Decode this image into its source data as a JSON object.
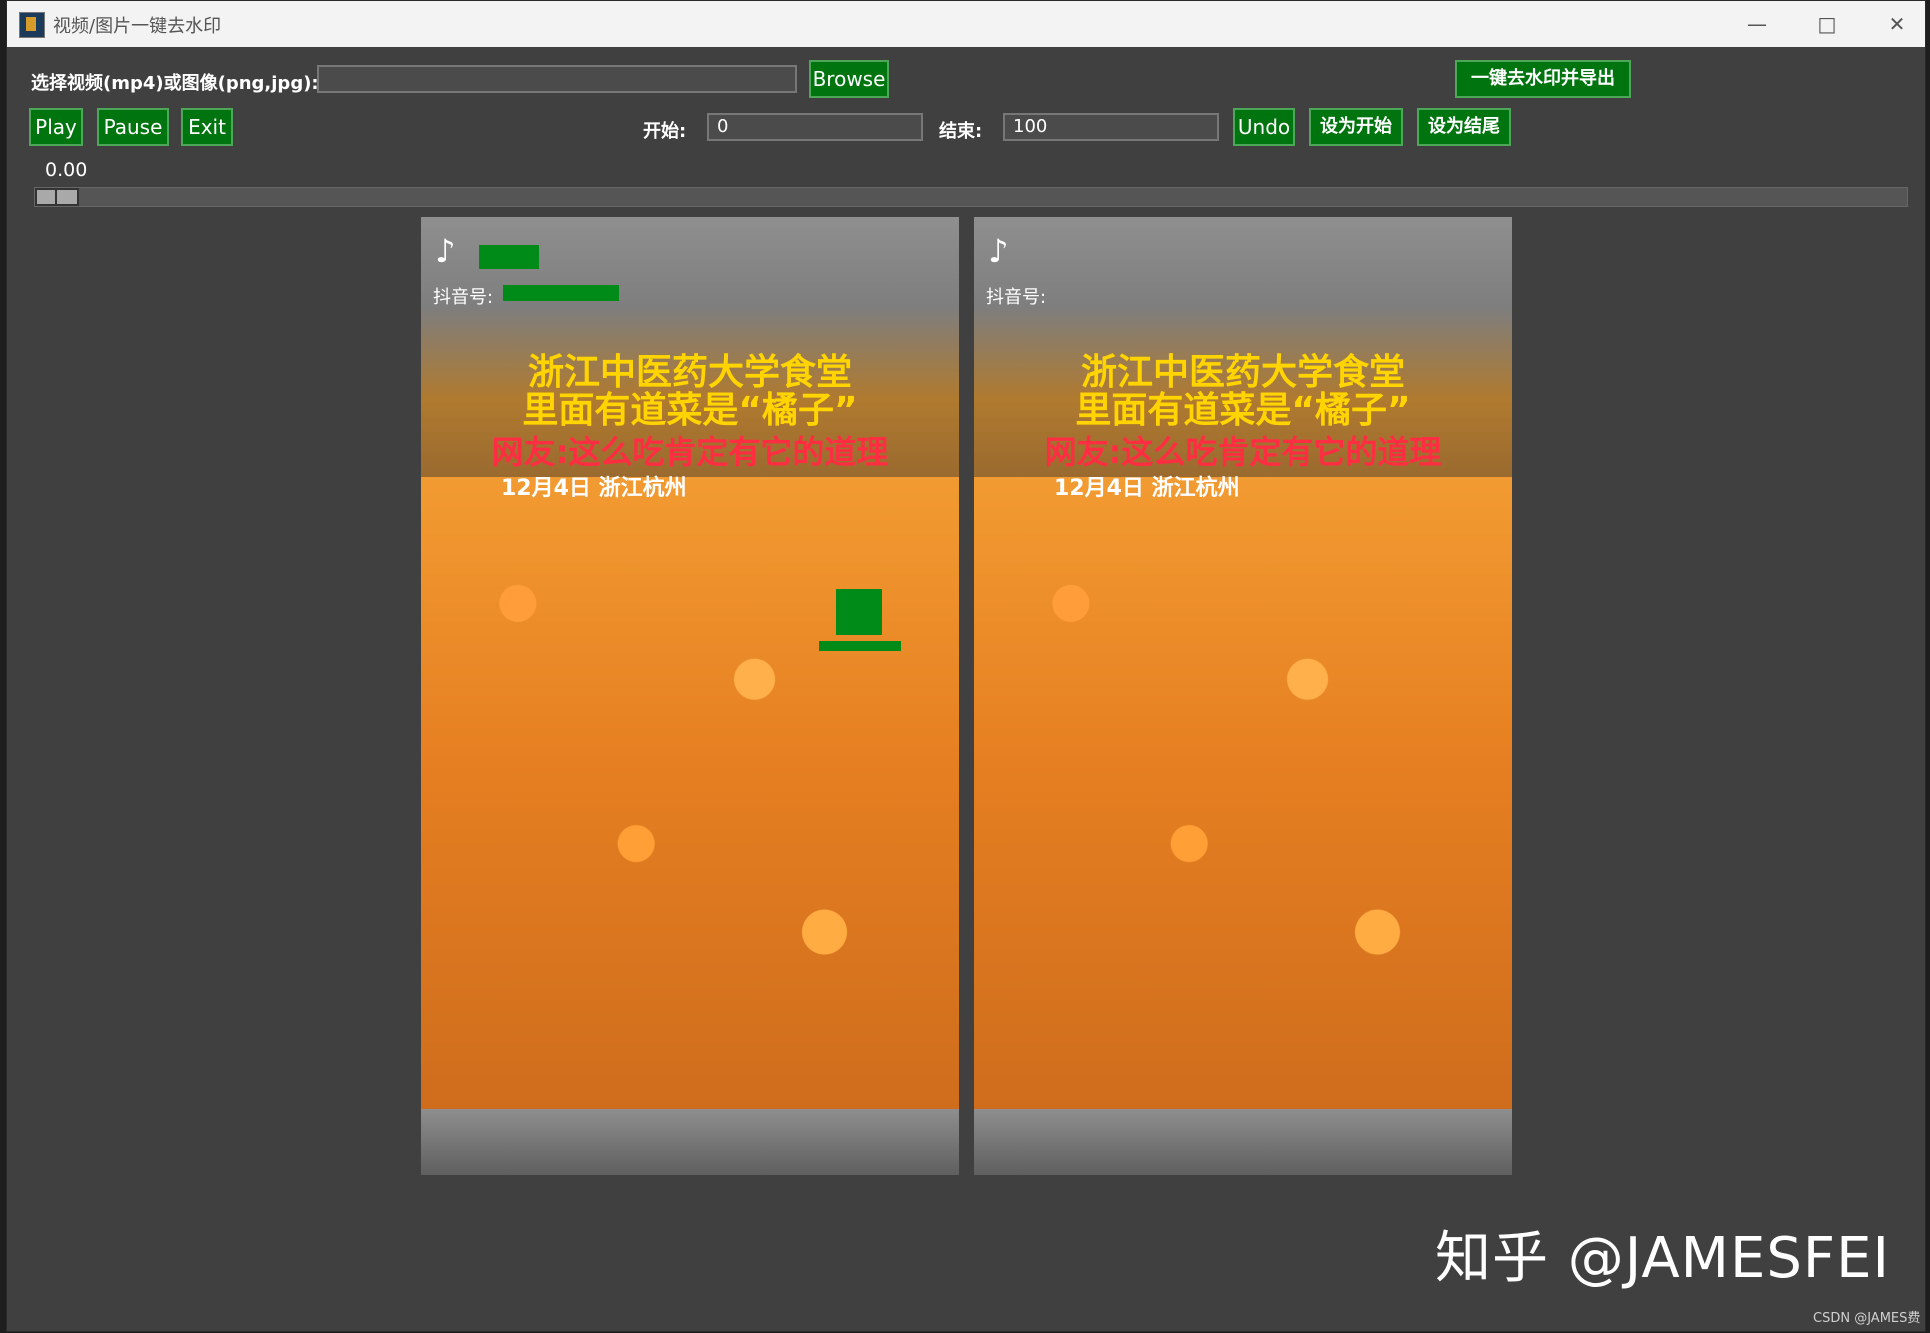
{
  "window": {
    "title": "视频/图片一键去水印",
    "icons": [
      "app-icon",
      "minimize-icon",
      "maximize-icon",
      "close-icon"
    ]
  },
  "top": {
    "select_label": "选择视频(mp4)或图像(png,jpg):",
    "file_value": "",
    "browse": "Browse",
    "export": "一键去水印并导出"
  },
  "controls": {
    "play": "Play",
    "pause": "Pause",
    "exit": "Exit",
    "start_label": "开始:",
    "start_value": "0",
    "end_label": "结束:",
    "end_value": "100",
    "undo": "Undo",
    "set_start": "设为开始",
    "set_end": "设为结尾"
  },
  "slider": {
    "value": "0.00"
  },
  "preview": {
    "account_label": "抖音号:",
    "title_line1": "浙江中医药大学食堂",
    "title_line2": "里面有道菜是“橘子”",
    "title_line3": "网友:这么吃肯定有它的道理",
    "date_line": "12月4日 浙江杭州"
  },
  "branding": {
    "watermark": "知乎 @JAMESFEI",
    "footer": "CSDN @JAMES费"
  },
  "colors": {
    "background": "#404040",
    "accent_green": "#00740f",
    "text": "#ffffff"
  }
}
